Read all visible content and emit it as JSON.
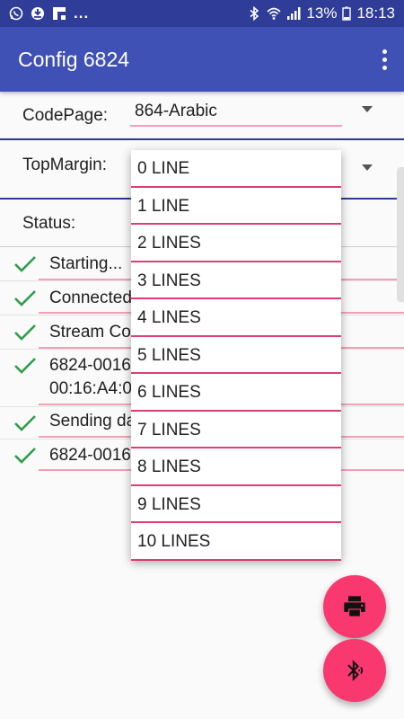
{
  "status_bar": {
    "left_icons": [
      "whatsapp-icon",
      "dnd-icon",
      "flipboard-icon"
    ],
    "more": "...",
    "battery": "13%",
    "time": "18:13",
    "right_icons": [
      "bluetooth-icon",
      "wifi-icon",
      "signal-icon",
      "battery-icon"
    ]
  },
  "app_bar": {
    "title": "Config 6824",
    "overflow_icon": "more-vert-icon"
  },
  "form": {
    "codepage_label": "CodePage:",
    "codepage_value": "864-Arabic",
    "topmargin_label": "TopMargin:",
    "status_label": "Status:"
  },
  "status_items": [
    {
      "text": "Starting...",
      "icon": "check-icon"
    },
    {
      "text": "Connected",
      "icon": "check-icon"
    },
    {
      "text": "Stream Co",
      "icon": "check-icon"
    },
    {
      "text": "6824-0016",
      "text2": "00:16:A4:0",
      "icon": "check-icon"
    },
    {
      "text": "Sending da",
      "icon": "check-icon"
    },
    {
      "text": "6824-0016",
      "icon": "check-icon"
    }
  ],
  "dropdown": {
    "options": [
      "0 LINE",
      "1 LINE",
      "2 LINES",
      "3 LINES",
      "4 LINES",
      "5 LINES",
      "6 LINES",
      "7 LINES",
      "8 LINES",
      "9 LINES",
      "10 LINES"
    ]
  },
  "fabs": {
    "print_icon": "print-icon",
    "bluetooth_icon": "bluetooth-searching-icon"
  },
  "colors": {
    "status_bar": "#2f3d99",
    "app_bar": "#3f51b5",
    "accent": "#f8386f",
    "check": "#2e9d4a",
    "underline": "#d81b60"
  }
}
